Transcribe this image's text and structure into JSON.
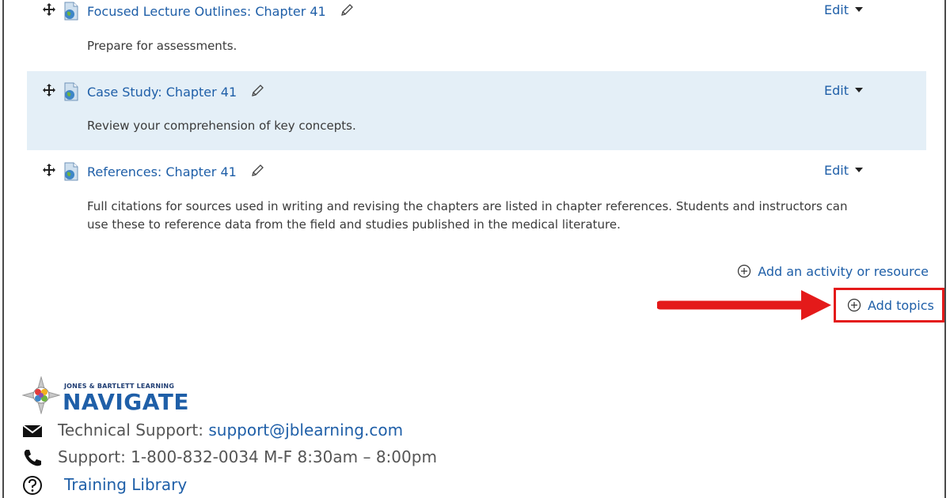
{
  "activities": [
    {
      "title": "Focused Lecture Outlines: Chapter 41",
      "edit_label": "Edit",
      "description": "Prepare for assessments."
    },
    {
      "title": "Case Study: Chapter 41",
      "edit_label": "Edit",
      "description": "Review your comprehension of key concepts."
    },
    {
      "title": "References: Chapter 41",
      "edit_label": "Edit",
      "description_line1": "Full citations for sources used in writing and revising the chapters are listed in chapter references. Students and instructors can",
      "description_line2": "use these to reference data from the field and studies published in the medical literature."
    }
  ],
  "actions": {
    "add_activity": "Add an activity or resource",
    "add_topics": "Add topics"
  },
  "footer": {
    "brand_small": "JONES & BARTLETT LEARNING",
    "brand_big": "NAVIGATE",
    "tech_support_label": "Technical Support:",
    "tech_support_email": "support@jblearning.com",
    "support_line": "Support: 1-800-832-0034 M-F 8:30am – 8:00pm",
    "training_library": "Training Library"
  },
  "icons": {
    "move": "move-icon",
    "file": "file-icon",
    "pencil": "pencil-icon",
    "plus": "plus-circle-icon",
    "mail": "mail-icon",
    "phone": "phone-icon",
    "help": "question-circle-icon"
  },
  "colors": {
    "link": "#1f5fa8",
    "highlight": "#e4eff7",
    "annotation": "#e41a1a"
  }
}
